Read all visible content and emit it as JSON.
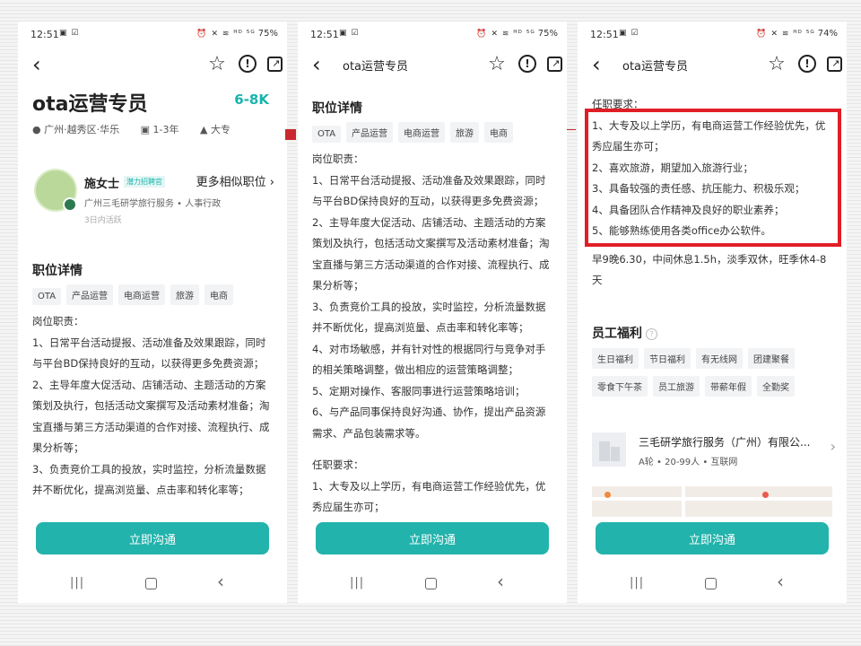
{
  "status": [
    {
      "time": "12:51",
      "left_icons": "▣ ☑",
      "sys_icons": "⏰ ✕ ≋ ᴴᴰ ⁵ᴳ",
      "battery": "75%"
    },
    {
      "time": "12:51",
      "left_icons": "▣ ☑",
      "sys_icons": "⏰ ✕ ≋ ᴴᴰ ⁵ᴳ",
      "battery": "75%"
    },
    {
      "time": "12:51",
      "left_icons": "▣ ☑",
      "sys_icons": "⏰ ✕ ≋ ᴴᴰ ⁵ᴳ",
      "battery": "74%"
    }
  ],
  "topbar": {
    "title": "ota运营专员",
    "back": "‹",
    "star": "☆",
    "warn": "!",
    "share": "↗"
  },
  "job": {
    "title": "ota运营专员",
    "salary": "6-8K",
    "location": "广州·越秀区·华乐",
    "experience": "1-3年",
    "education": "大专"
  },
  "recruiter": {
    "name": "施女士",
    "tag": "潜力招聘官",
    "more": "更多相似职位",
    "company": "广州三毛研学旅行服务 • 人事行政",
    "active": "3日内活跃"
  },
  "detail": {
    "section_title": "职位详情",
    "tags": [
      "OTA",
      "产品运营",
      "电商运营",
      "旅游",
      "电商"
    ],
    "duty_header": "岗位职责：",
    "duties": [
      "1、日常平台活动提报、活动准备及效果跟踪，同时与平台BD保持良好的互动，以获得更多免费资源；",
      "2、主导年度大促活动、店铺活动、主题活动的方案策划及执行，包括活动文案撰写及活动素材准备；淘宝直播与第三方活动渠道的合作对接、流程执行、成果分析等；",
      "3、负责竞价工具的投放，实时监控，分析流量数据并不断优化，提高浏览量、点击率和转化率等；",
      "4、对市场敏感，并有针对性的根据同行与竞争对手的相关策略调整，做出相应的运营策略调整；",
      "5、定期对操作、客服同事进行运营策略培训；",
      "6、与产品同事保持良好沟通、协作，提出产品资源需求、产品包装需求等。"
    ],
    "req_header": "任职要求：",
    "requirements": [
      "1、大专及以上学历，有电商运营工作经验优先，优秀应届生亦可；",
      "2、喜欢旅游，期望加入旅游行业；",
      "3、具备较强的责任感、抗压能力、积极乐观；",
      "4、具备团队合作精神及良好的职业素养；",
      "5、能够熟练使用各类office办公软件。"
    ],
    "schedule": "早9晚6.30，中间休息1.5h，淡季双休，旺季休4-8天"
  },
  "welfare": {
    "title": "员工福利",
    "info_icon": "?",
    "row1": [
      "生日福利",
      "节日福利",
      "有无线网",
      "团建聚餐"
    ],
    "row2": [
      "零食下午茶",
      "员工旅游",
      "带薪年假",
      "全勤奖"
    ]
  },
  "company": {
    "name": "三毛研学旅行服务（广州）有限公...",
    "info": "A轮 • 20-99人 • 互联网",
    "arrow": "›"
  },
  "cta": "立即沟通",
  "nav": {
    "recent": "|||",
    "back": "‹"
  },
  "colors": {
    "accent": "#22b3ac",
    "highlight": "#e01e26"
  }
}
